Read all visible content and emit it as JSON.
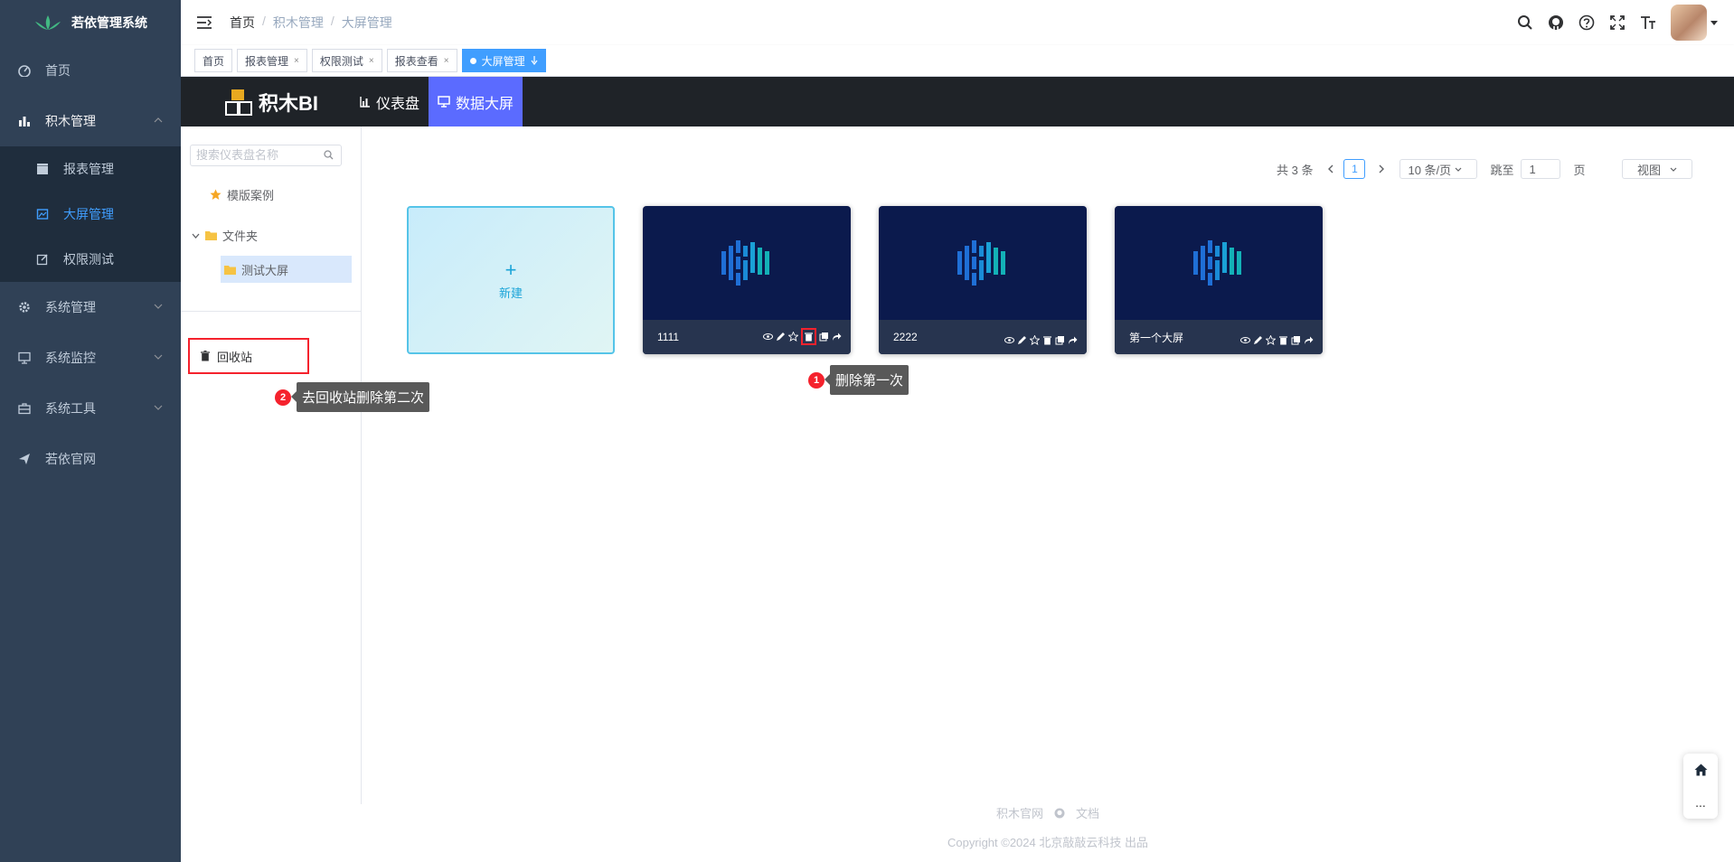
{
  "app": {
    "logo_text": "若依管理系统"
  },
  "sidebar": {
    "items": [
      {
        "label": "首页",
        "icon": "dashboard-icon"
      },
      {
        "label": "积木管理",
        "icon": "chart-icon"
      },
      {
        "label": "报表管理",
        "icon": "clapper-icon"
      },
      {
        "label": "大屏管理",
        "icon": "image-icon"
      },
      {
        "label": "权限测试",
        "icon": "edit-icon"
      },
      {
        "label": "系统管理",
        "icon": "gear-icon"
      },
      {
        "label": "系统监控",
        "icon": "monitor-icon"
      },
      {
        "label": "系统工具",
        "icon": "toolbox-icon"
      },
      {
        "label": "若依官网",
        "icon": "send-icon"
      }
    ]
  },
  "breadcrumb": [
    "首页",
    "积木管理",
    "大屏管理"
  ],
  "tags": [
    {
      "label": "首页"
    },
    {
      "label": "报表管理"
    },
    {
      "label": "权限测试"
    },
    {
      "label": "报表查看"
    },
    {
      "label": "大屏管理"
    }
  ],
  "bi": {
    "logo": "积木BI",
    "tabs": [
      "仪表盘",
      "数据大屏"
    ]
  },
  "tree": {
    "search_placeholder": "搜索仪表盘名称",
    "template": "模版案例",
    "folder": "文件夹",
    "child": "测试大屏",
    "recycle": "回收站"
  },
  "pager": {
    "total": "共 3 条",
    "current": "1",
    "page_size": "10 条/页",
    "jump_label": "跳至",
    "jump_value": "1",
    "page_unit": "页",
    "view": "视图"
  },
  "cards": {
    "new_label": "新建",
    "plus": "+",
    "screens": [
      "1111",
      "2222",
      "第一个大屏"
    ]
  },
  "callouts": [
    {
      "num": "1",
      "text": "删除第一次"
    },
    {
      "num": "2",
      "text": "去回收站删除第二次"
    }
  ],
  "footer": {
    "site": "积木官网",
    "docs": "文档",
    "copyright": "Copyright ©2024 北京敲敲云科技 出品"
  },
  "float": {
    "more": "..."
  },
  "colors": {
    "sidebar": "#304156",
    "primary": "#409eff",
    "bi_header": "#1f2328",
    "bi_active": "#5b6bff",
    "callout": "#f5222d"
  }
}
